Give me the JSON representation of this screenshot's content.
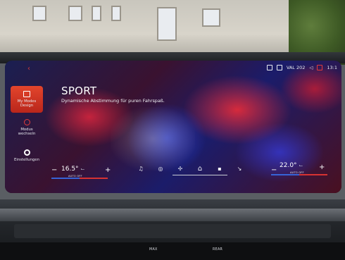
{
  "screen": {
    "title": "SPORT",
    "subtitle": "Dynamische Abstimmung für puren Fahrspaß."
  },
  "status_bar": {
    "location_label": "VAL 202",
    "time": "13:1"
  },
  "sidebar": {
    "items": [
      {
        "label_line1": "My Modes",
        "label_line2": "Design",
        "icon": "display-icon",
        "active": true
      },
      {
        "label_line1": "Modus",
        "label_line2": "wechseln",
        "icon": "mode-switch-icon",
        "active": false
      },
      {
        "label_line1": "Einstellungen",
        "label_line2": "",
        "icon": "gear-icon",
        "active": false
      }
    ]
  },
  "climate": {
    "left_temp": "16.5°",
    "left_mode": "AUTO OFF",
    "right_temp": "22.0°",
    "right_mode": "AUTO OFF",
    "minus": "−",
    "plus": "+"
  },
  "dock": {
    "icons": [
      "music-icon",
      "navigation-icon",
      "fan-icon",
      "home-icon",
      "apps-icon",
      "phone-icon"
    ]
  },
  "dashboard": {
    "button_labels": [
      "MAX",
      "REAR"
    ]
  },
  "colors": {
    "accent_red": "#d63232",
    "accent_blue": "#3763d6",
    "active_tile": "#e3452c"
  }
}
